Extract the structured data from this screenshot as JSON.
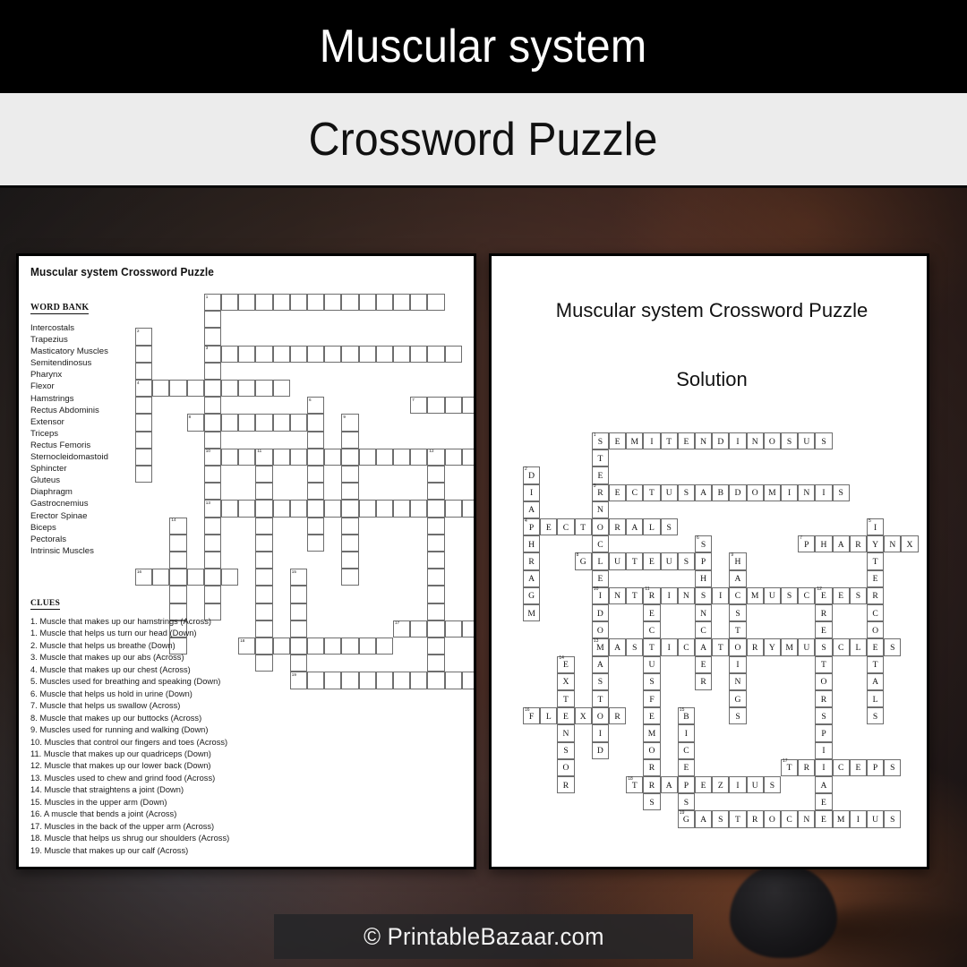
{
  "header": {
    "title": "Muscular system",
    "subtitle": "Crossword Puzzle"
  },
  "footer": {
    "watermark": "© PrintableBazaar.com"
  },
  "puzzle_page": {
    "heading": "Muscular system Crossword Puzzle",
    "word_bank_title": "WORD BANK",
    "word_bank": [
      "Intercostals",
      "Trapezius",
      "Masticatory Muscles",
      "Semitendinosus",
      "Pharynx",
      "Flexor",
      "Hamstrings",
      "Rectus Abdominis",
      "Extensor",
      "Triceps",
      "Rectus Femoris",
      "Sternocleidomastoid",
      "Sphincter",
      "Gluteus",
      "Diaphragm",
      "Gastrocnemius",
      "Erector Spinae",
      "Biceps",
      "Pectorals",
      "Intrinsic Muscles"
    ],
    "clues_title": "CLUES",
    "clues": [
      "1. Muscle that makes up our hamstrings (Across)",
      "1. Muscle that helps us turn our head (Down)",
      "2. Muscle that helps us breathe (Down)",
      "3. Muscle that makes up our abs (Across)",
      "4. Muscle that makes up our chest (Across)",
      "5. Muscles used for breathing and speaking (Down)",
      "6. Muscle that helps us hold in urine (Down)",
      "7. Muscle that helps us swallow (Across)",
      "8. Muscle that makes up our buttocks (Across)",
      "9. Muscles used for running and walking (Down)",
      "10. Muscles that control our fingers and toes (Across)",
      "11. Muscle that makes up our quadriceps (Down)",
      "12. Muscle that makes up our lower back (Down)",
      "13. Muscles used to chew and grind food (Across)",
      "14. Muscle that straightens a joint (Down)",
      "15. Muscles in the upper arm (Down)",
      "16. A muscle that bends a joint (Across)",
      "17. Muscles in the back of the upper arm (Across)",
      "18. Muscle that helps us shrug our shoulders (Across)",
      "19. Muscle that makes up our calf (Across)"
    ]
  },
  "solution_page": {
    "heading": "Muscular system Crossword Puzzle",
    "subheading": "Solution"
  },
  "chart_data": {
    "type": "table",
    "title": "Muscular system Crossword Puzzle",
    "cell_size_px": 19.2,
    "grid_cols": 23,
    "grid_rows": 23,
    "entries": [
      {
        "number": 1,
        "direction": "across",
        "answer": "SEMITENDINOSUS",
        "clue": "Muscle that makes up our hamstrings",
        "row": 0,
        "col": 4
      },
      {
        "number": 1,
        "direction": "down",
        "answer": "STERNOCLEIDOMASTOID",
        "clue": "Muscle that helps us turn our head",
        "row": 0,
        "col": 4
      },
      {
        "number": 2,
        "direction": "down",
        "answer": "DIAPHRAGM",
        "clue": "Muscle that helps us breathe",
        "row": 2,
        "col": 0
      },
      {
        "number": 3,
        "direction": "across",
        "answer": "RECTUSABDOMINIS",
        "clue": "Muscle that makes up our abs",
        "row": 3,
        "col": 4
      },
      {
        "number": 4,
        "direction": "across",
        "answer": "PECTORALS",
        "clue": "Muscle that makes up our chest",
        "row": 5,
        "col": 0
      },
      {
        "number": 5,
        "direction": "down",
        "answer": "INTERCOSTALS",
        "clue": "Muscles used for breathing and speaking",
        "row": 5,
        "col": 20
      },
      {
        "number": 6,
        "direction": "down",
        "answer": "SPHINCTER",
        "clue": "Muscle that helps us hold in urine",
        "row": 6,
        "col": 10
      },
      {
        "number": 7,
        "direction": "across",
        "answer": "PHARYNX",
        "clue": "Muscle that helps us swallow",
        "row": 6,
        "col": 16
      },
      {
        "number": 8,
        "direction": "across",
        "answer": "GLUTEUS",
        "clue": "Muscle that makes up our buttocks",
        "row": 7,
        "col": 3
      },
      {
        "number": 9,
        "direction": "down",
        "answer": "HAMSTRINGS",
        "clue": "Muscles used for running and walking",
        "row": 7,
        "col": 12
      },
      {
        "number": 10,
        "direction": "across",
        "answer": "INTRINSICMUSCLES",
        "clue": "Muscles that control our fingers and toes",
        "row": 9,
        "col": 4
      },
      {
        "number": 11,
        "direction": "down",
        "answer": "RECTUSFEMORIS",
        "clue": "Muscle that makes up our quadriceps",
        "row": 9,
        "col": 7
      },
      {
        "number": 12,
        "direction": "down",
        "answer": "ERECTORSPINAE",
        "clue": "Muscle that makes up our lower back",
        "row": 9,
        "col": 17
      },
      {
        "number": 13,
        "direction": "across",
        "answer": "MASTICATORYMUSCLES",
        "clue": "Muscles used to chew and grind food",
        "row": 12,
        "col": 4
      },
      {
        "number": 14,
        "direction": "down",
        "answer": "EXTENSOR",
        "clue": "Muscle that straightens a joint",
        "row": 13,
        "col": 2
      },
      {
        "number": 15,
        "direction": "down",
        "answer": "BICEPS",
        "clue": "Muscles in the upper arm",
        "row": 16,
        "col": 9
      },
      {
        "number": 16,
        "direction": "across",
        "answer": "FLEXOR",
        "clue": "A muscle that bends a joint",
        "row": 16,
        "col": 0
      },
      {
        "number": 17,
        "direction": "across",
        "answer": "TRICEPS",
        "clue": "Muscles in the back of the upper arm",
        "row": 19,
        "col": 15
      },
      {
        "number": 18,
        "direction": "across",
        "answer": "TRAPEZIUS",
        "clue": "Muscle that helps us shrug our shoulders",
        "row": 20,
        "col": 6
      },
      {
        "number": 19,
        "direction": "across",
        "answer": "GASTROCNEMIUS",
        "clue": "Muscle that makes up our calf",
        "row": 22,
        "col": 9
      }
    ]
  }
}
